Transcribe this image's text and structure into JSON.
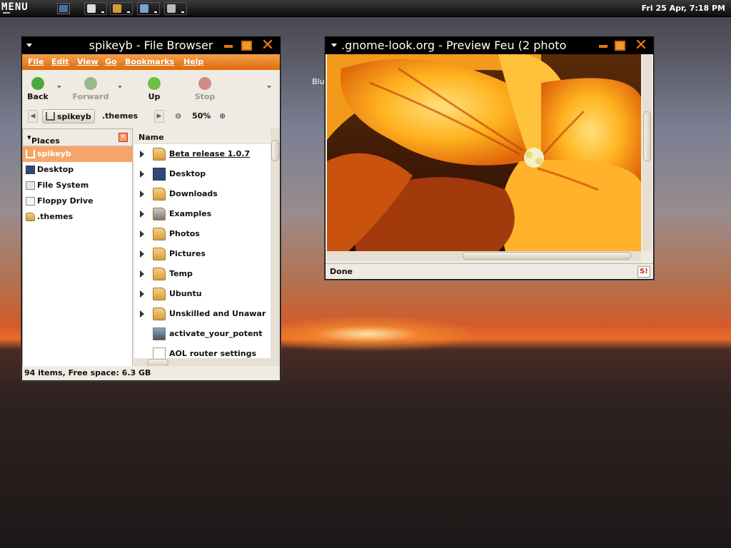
{
  "panel": {
    "menu_label": "MENU",
    "clock": "Fri 25 Apr,  7:18 PM"
  },
  "desktop": {
    "hidden_label": "Blu"
  },
  "file_browser": {
    "title": "spikeyb - File Browser",
    "menus": [
      "File",
      "Edit",
      "View",
      "Go",
      "Bookmarks",
      "Help"
    ],
    "toolbar": {
      "back": "Back",
      "forward": "Forward",
      "up": "Up",
      "stop": "Stop"
    },
    "path": [
      "spikeyb",
      ".themes"
    ],
    "zoom": "50%",
    "places_title": "Places",
    "places": [
      "spikeyb",
      "Desktop",
      "File System",
      "Floppy Drive",
      ".themes"
    ],
    "column_name": "Name",
    "files": [
      "Beta release 1.0.7",
      "Desktop",
      "Downloads",
      "Examples",
      "Photos",
      "Pictures",
      "Temp",
      "Ubuntu",
      "Unskilled and Unawar",
      "activate_your_potent",
      "AOL router settings"
    ],
    "status": "94 items, Free space: 6.3 GB"
  },
  "browser": {
    "title": ".gnome-look.org - Preview Feu (2 photo",
    "status": "Done",
    "security_icon": "S!"
  },
  "colors": {
    "accent_orange": "#df6a0a",
    "selection": "#f6a56a",
    "panel": "#111111"
  }
}
